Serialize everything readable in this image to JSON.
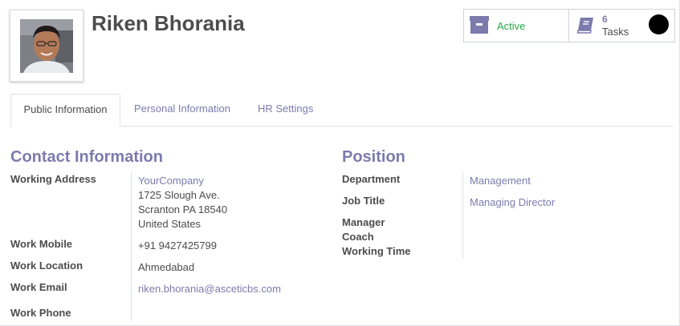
{
  "employee": {
    "name": "Riken Bhorania"
  },
  "smart_buttons": {
    "active": {
      "label": "Active",
      "icon": "archive-icon"
    },
    "tasks": {
      "count": "6",
      "label": "Tasks",
      "icon": "book-icon"
    }
  },
  "tabs": [
    {
      "label": "Public Information",
      "active": true
    },
    {
      "label": "Personal Information",
      "active": false
    },
    {
      "label": "HR Settings",
      "active": false
    }
  ],
  "contact": {
    "title": "Contact Information",
    "working_address_label": "Working Address",
    "working_address": {
      "company": "YourCompany",
      "street": "1725 Slough Ave.",
      "city_line": "Scranton PA 18540",
      "country": "United States"
    },
    "work_mobile_label": "Work Mobile",
    "work_mobile": "+91 9427425799",
    "work_location_label": "Work Location",
    "work_location": "Ahmedabad",
    "work_email_label": "Work Email",
    "work_email": "riken.bhorania@asceticbs.com",
    "work_phone_label": "Work Phone"
  },
  "position": {
    "title": "Position",
    "department_label": "Department",
    "department": "Management",
    "job_title_label": "Job Title",
    "job_title": "Managing Director",
    "manager_label": "Manager",
    "coach_label": "Coach",
    "working_time_label": "Working Time"
  },
  "colors": {
    "accent": "#7c7bad",
    "active_green": "#28a745",
    "text": "#4c4c4c",
    "border": "#dee2e6"
  }
}
